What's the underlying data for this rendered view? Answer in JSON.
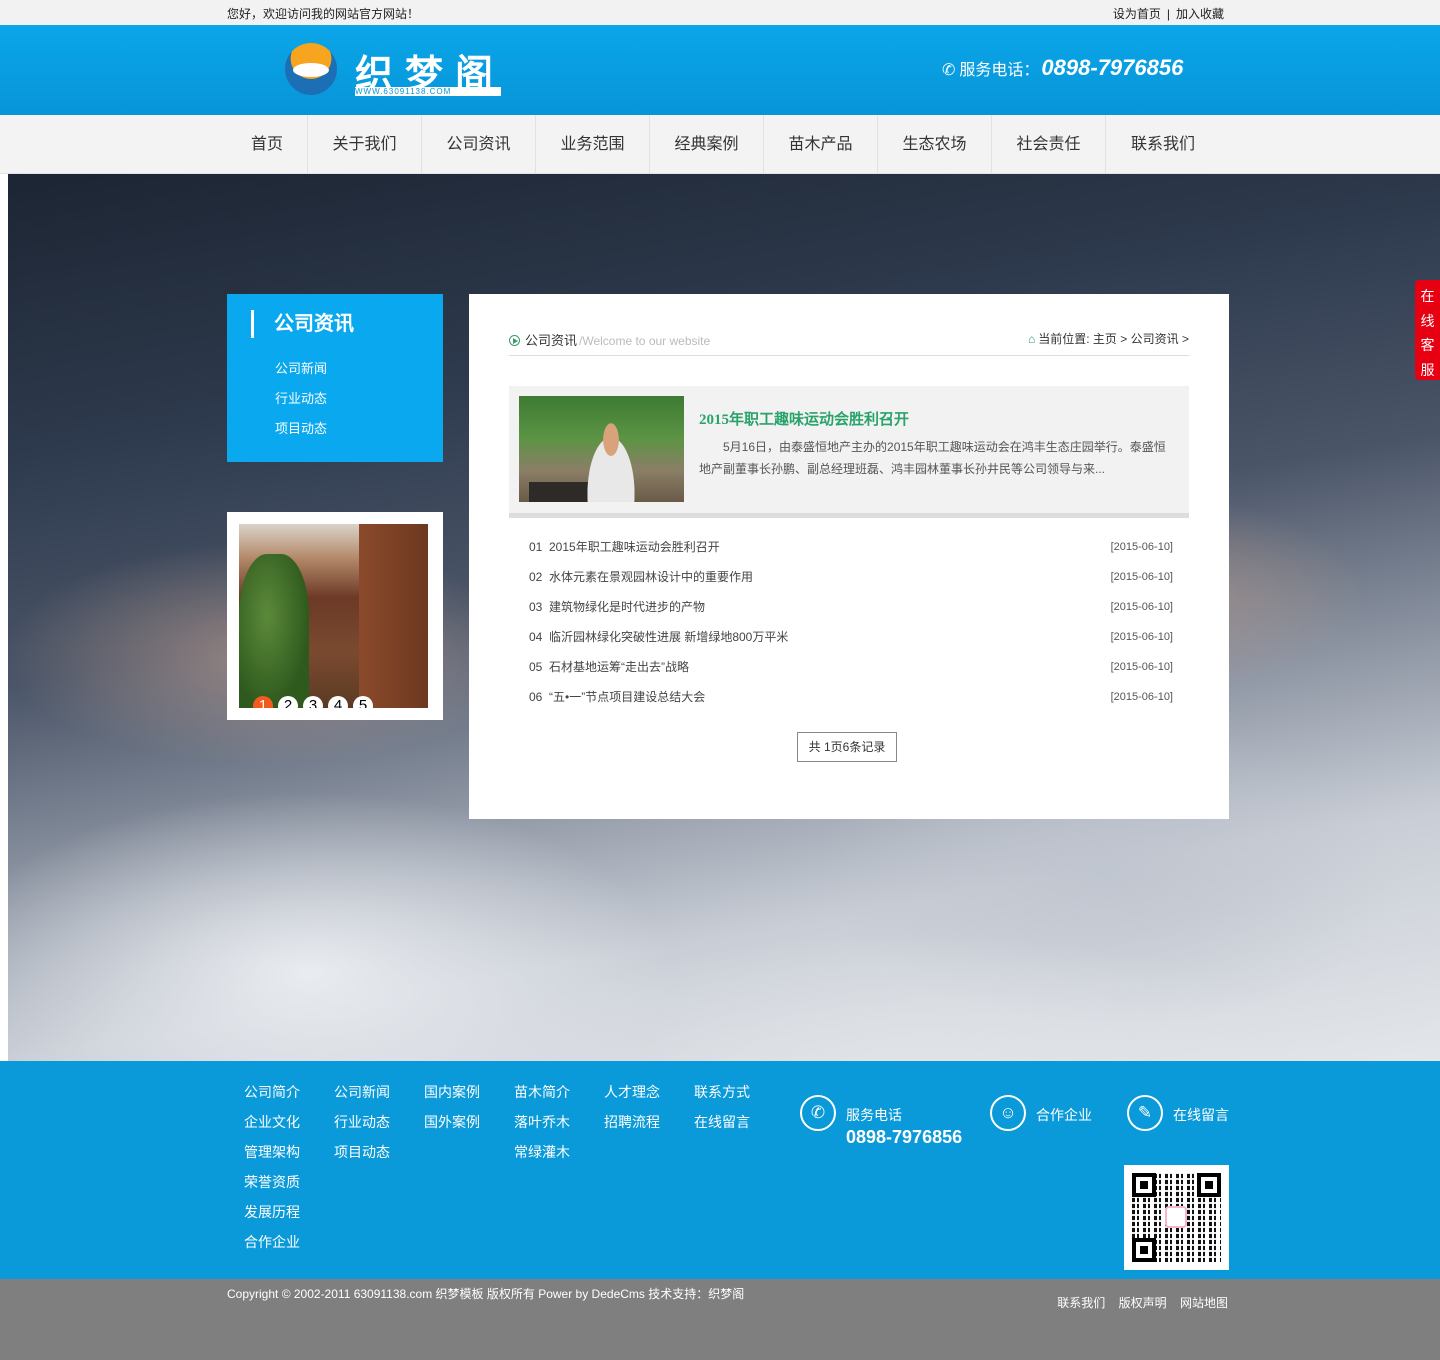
{
  "topbar": {
    "welcome": "您好，欢迎访问我的网站官方网站！",
    "set_home": "设为首页",
    "separator": "|",
    "add_favorite": "加入收藏"
  },
  "header": {
    "logo_text": "织梦阁",
    "logo_url": "WWW.63091138.COM",
    "hotline_label": "服务电话：",
    "hotline_number": "0898-7976856"
  },
  "nav": {
    "items": [
      {
        "label": "首页"
      },
      {
        "label": "关于我们"
      },
      {
        "label": "公司资讯"
      },
      {
        "label": "业务范围"
      },
      {
        "label": "经典案例"
      },
      {
        "label": "苗木产品"
      },
      {
        "label": "生态农场"
      },
      {
        "label": "社会责任"
      },
      {
        "label": "联系我们"
      }
    ]
  },
  "sidebar": {
    "title": "公司资讯",
    "items": [
      {
        "label": "公司新闻"
      },
      {
        "label": "行业动态"
      },
      {
        "label": "项目动态"
      }
    ],
    "slides": [
      "1",
      "2",
      "3",
      "4",
      "5"
    ],
    "active_slide": 1
  },
  "main": {
    "category": "公司资讯",
    "category_en": "/Welcome to our website",
    "location_label": "当前位置:",
    "breadcrumb": [
      "主页",
      "公司资讯"
    ],
    "breadcrumb_sep": ">",
    "featured": {
      "title": "2015年职工趣味运动会胜利召开",
      "desc": "5月16日，由泰盛恒地产主办的2015年职工趣味运动会在鸿丰生态庄园举行。泰盛恒地产副董事长孙鹏、副总经理班磊、鸿丰园林董事长孙井民等公司领导与来..."
    },
    "articles": [
      {
        "no": "01",
        "title": "2015年职工趣味运动会胜利召开",
        "date": "[2015-06-10]"
      },
      {
        "no": "02",
        "title": "水体元素在景观园林设计中的重要作用",
        "date": "[2015-06-10]"
      },
      {
        "no": "03",
        "title": "建筑物绿化是时代进步的产物",
        "date": "[2015-06-10]"
      },
      {
        "no": "04",
        "title": "临沂园林绿化突破性进展 新增绿地800万平米",
        "date": "[2015-06-10]"
      },
      {
        "no": "05",
        "title": "石材基地运筹“走出去”战略",
        "date": "[2015-06-10]"
      },
      {
        "no": "06",
        "title": "“五•一”节点项目建设总结大会",
        "date": "[2015-06-10]"
      }
    ],
    "pager": "共 1页6条记录"
  },
  "kefu": [
    "在",
    "线",
    "客",
    "服"
  ],
  "footer": {
    "columns": [
      [
        "公司简介",
        "企业文化",
        "管理架构",
        "荣誉资质",
        "发展历程",
        "合作企业"
      ],
      [
        "公司新闻",
        "行业动态",
        "项目动态"
      ],
      [
        "国内案例",
        "国外案例"
      ],
      [
        "苗木简介",
        "落叶乔木",
        "常绿灌木"
      ],
      [
        "人才理念",
        "招聘流程"
      ],
      [
        "联系方式",
        "在线留言"
      ]
    ],
    "service_label": "服务电话",
    "service_number": "0898-7976856",
    "partner_label": "合作企业",
    "message_label": "在线留言"
  },
  "copyright": {
    "text": "Copyright © 2002-2011 63091138.com 织梦模板 版权所有 Power by DedeCms 技术支持：织梦阁",
    "links": [
      "联系我们",
      "版权声明",
      "网站地图"
    ]
  }
}
